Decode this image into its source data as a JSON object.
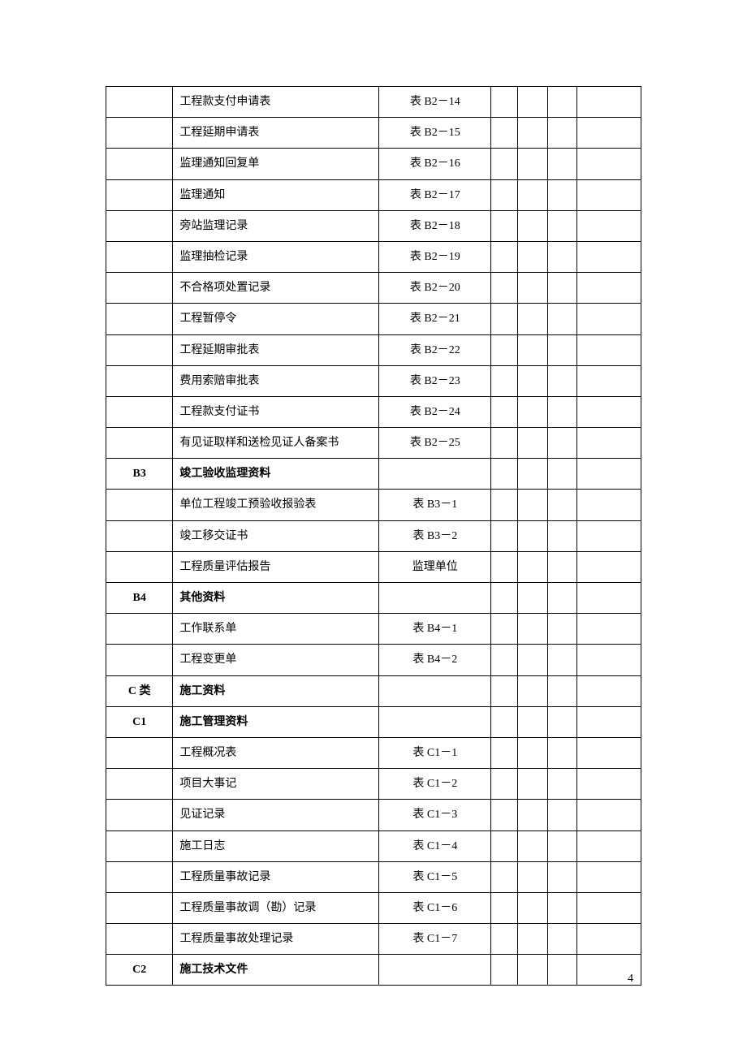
{
  "page_number": "4",
  "rows": [
    {
      "code": "",
      "name": "工程款支付申请表",
      "ref": "表 B2－14",
      "bold": false
    },
    {
      "code": "",
      "name": "工程延期申请表",
      "ref": "表 B2－15",
      "bold": false
    },
    {
      "code": "",
      "name": "监理通知回复单",
      "ref": "表 B2－16",
      "bold": false
    },
    {
      "code": "",
      "name": "监理通知",
      "ref": "表 B2－17",
      "bold": false
    },
    {
      "code": "",
      "name": "旁站监理记录",
      "ref": "表 B2－18",
      "bold": false
    },
    {
      "code": "",
      "name": "监理抽检记录",
      "ref": "表 B2－19",
      "bold": false
    },
    {
      "code": "",
      "name": "不合格项处置记录",
      "ref": "表 B2－20",
      "bold": false
    },
    {
      "code": "",
      "name": "工程暂停令",
      "ref": "表 B2－21",
      "bold": false
    },
    {
      "code": "",
      "name": "工程延期审批表",
      "ref": "表 B2－22",
      "bold": false
    },
    {
      "code": "",
      "name": "费用索赔审批表",
      "ref": "表 B2－23",
      "bold": false
    },
    {
      "code": "",
      "name": "工程款支付证书",
      "ref": "表 B2－24",
      "bold": false
    },
    {
      "code": "",
      "name": "有见证取样和送检见证人备案书",
      "ref": "表 B2－25",
      "bold": false
    },
    {
      "code": "B3",
      "name": "竣工验收监理资料",
      "ref": "",
      "bold": true
    },
    {
      "code": "",
      "name": "单位工程竣工预验收报验表",
      "ref": "表 B3－1",
      "bold": false
    },
    {
      "code": "",
      "name": "竣工移交证书",
      "ref": "表 B3－2",
      "bold": false
    },
    {
      "code": "",
      "name": "工程质量评估报告",
      "ref": "监理单位",
      "bold": false
    },
    {
      "code": "B4",
      "name": "其他资料",
      "ref": "",
      "bold": true
    },
    {
      "code": "",
      "name": "工作联系单",
      "ref": "表 B4－1",
      "bold": false
    },
    {
      "code": "",
      "name": "工程变更单",
      "ref": "表 B4－2",
      "bold": false
    },
    {
      "code": "C 类",
      "name": "施工资料",
      "ref": "",
      "bold": true
    },
    {
      "code": "C1",
      "name": "施工管理资料",
      "ref": "",
      "bold": true
    },
    {
      "code": "",
      "name": "工程概况表",
      "ref": "表 C1－1",
      "bold": false
    },
    {
      "code": "",
      "name": "项目大事记",
      "ref": "表 C1－2",
      "bold": false
    },
    {
      "code": "",
      "name": "见证记录",
      "ref": "表 C1－3",
      "bold": false
    },
    {
      "code": "",
      "name": "施工日志",
      "ref": "表 C1－4",
      "bold": false
    },
    {
      "code": "",
      "name": "工程质量事故记录",
      "ref": "表 C1－5",
      "bold": false
    },
    {
      "code": "",
      "name": "工程质量事故调（勘）记录",
      "ref": "表 C1－6",
      "bold": false
    },
    {
      "code": "",
      "name": "工程质量事故处理记录",
      "ref": "表 C1－7",
      "bold": false
    },
    {
      "code": "C2",
      "name": "施工技术文件",
      "ref": "",
      "bold": true
    }
  ]
}
